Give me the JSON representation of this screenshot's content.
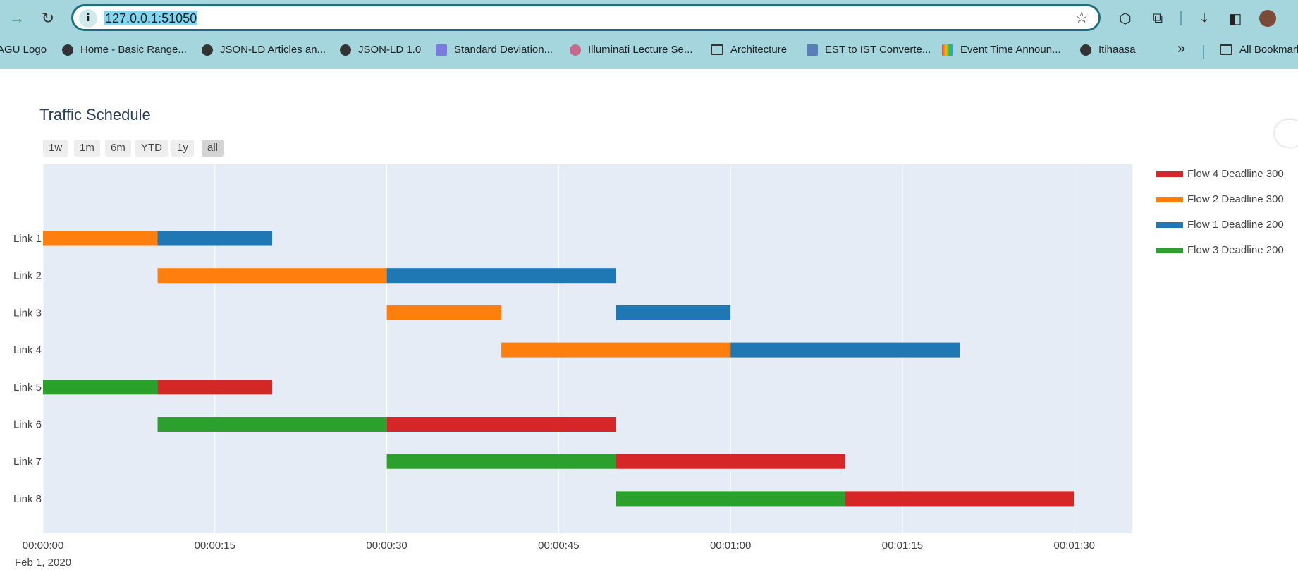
{
  "browser": {
    "url": "127.0.0.1:51050",
    "site_info_glyph": "i",
    "bookmarks": [
      "AGU Logo",
      "Home - Basic Range...",
      "JSON-LD Articles an...",
      "JSON-LD 1.0",
      "Standard Deviation...",
      "Illuminati Lecture Se...",
      "Architecture",
      "EST to IST Converte...",
      "Event Time Announ...",
      "Itihaasa"
    ],
    "overflow_label": "»",
    "all_bookmarks": "All Bookmarks"
  },
  "chart": {
    "title": "Traffic Schedule",
    "range_buttons": [
      "1w",
      "1m",
      "6m",
      "YTD",
      "1y",
      "all"
    ],
    "active_range": "all"
  },
  "chart_data": {
    "type": "gantt",
    "title": "Traffic Schedule",
    "x_axis": {
      "type": "date",
      "range": [
        "2020-02-01 00:00:00",
        "2020-02-01 00:01:35"
      ],
      "tick_labels": [
        "00:00:00",
        "00:00:15",
        "00:00:30",
        "00:00:45",
        "00:01:00",
        "00:01:15",
        "00:01:30"
      ],
      "date_label": "Feb 1, 2020"
    },
    "categories": [
      "Link 1",
      "Link 2",
      "Link 3",
      "Link 4",
      "Link 5",
      "Link 6",
      "Link 7",
      "Link 8"
    ],
    "series": [
      {
        "name": "Flow 4 Deadline 300",
        "color": "#d62728",
        "tasks": [
          {
            "link": "Link 5",
            "start": "2020-02-01 00:00:10",
            "end": "2020-02-01 00:00:20"
          },
          {
            "link": "Link 6",
            "start": "2020-02-01 00:00:30",
            "end": "2020-02-01 00:00:50"
          },
          {
            "link": "Link 7",
            "start": "2020-02-01 00:00:50",
            "end": "2020-02-01 00:01:10"
          },
          {
            "link": "Link 8",
            "start": "2020-02-01 00:01:10",
            "end": "2020-02-01 00:01:30"
          }
        ]
      },
      {
        "name": "Flow 2 Deadline 300",
        "color": "#ff7f0e",
        "tasks": [
          {
            "link": "Link 1",
            "start": "2020-02-01 00:00:00",
            "end": "2020-02-01 00:00:10"
          },
          {
            "link": "Link 2",
            "start": "2020-02-01 00:00:10",
            "end": "2020-02-01 00:00:30"
          },
          {
            "link": "Link 3",
            "start": "2020-02-01 00:00:30",
            "end": "2020-02-01 00:00:40"
          },
          {
            "link": "Link 4",
            "start": "2020-02-01 00:00:40",
            "end": "2020-02-01 00:01:00"
          }
        ]
      },
      {
        "name": "Flow 1 Deadline 200",
        "color": "#1f77b4",
        "tasks": [
          {
            "link": "Link 1",
            "start": "2020-02-01 00:00:10",
            "end": "2020-02-01 00:00:20"
          },
          {
            "link": "Link 2",
            "start": "2020-02-01 00:00:30",
            "end": "2020-02-01 00:00:50"
          },
          {
            "link": "Link 3",
            "start": "2020-02-01 00:00:50",
            "end": "2020-02-01 00:01:00"
          },
          {
            "link": "Link 4",
            "start": "2020-02-01 00:01:00",
            "end": "2020-02-01 00:01:20"
          }
        ]
      },
      {
        "name": "Flow 3 Deadline 200",
        "color": "#2ca02c",
        "tasks": [
          {
            "link": "Link 5",
            "start": "2020-02-01 00:00:00",
            "end": "2020-02-01 00:00:10"
          },
          {
            "link": "Link 6",
            "start": "2020-02-01 00:00:10",
            "end": "2020-02-01 00:00:30"
          },
          {
            "link": "Link 7",
            "start": "2020-02-01 00:00:30",
            "end": "2020-02-01 00:00:50"
          },
          {
            "link": "Link 8",
            "start": "2020-02-01 00:00:50",
            "end": "2020-02-01 00:01:10"
          }
        ]
      }
    ],
    "grid": true,
    "legend_position": "right"
  }
}
